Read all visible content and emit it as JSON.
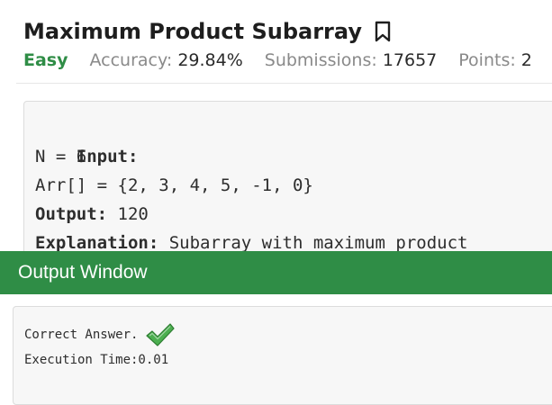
{
  "problem": {
    "title": "Maximum Product Subarray",
    "difficulty": "Easy",
    "accuracy_label": "Accuracy:",
    "accuracy_value": "29.84%",
    "submissions_label": "Submissions:",
    "submissions_value": "17657",
    "points_label": "Points:",
    "points_value": "2"
  },
  "example": {
    "input_label": "Input:",
    "n_line": "N = 6",
    "arr_line": "Arr[] = {2, 3, 4, 5, -1, 0}",
    "output_label": "Output:",
    "output_value": " 120",
    "explanation_label": "Explanation:",
    "explanation_value": " Subarray with maximum product"
  },
  "output_window": {
    "title": "Output Window",
    "result_text": "Correct Answer.",
    "execution_time": "Execution Time:0.01"
  },
  "colors": {
    "brand_green": "#2f8d46",
    "check_green": "#4caf50"
  },
  "icons": {
    "bookmark": "bookmark-icon",
    "check": "checkmark-icon"
  }
}
